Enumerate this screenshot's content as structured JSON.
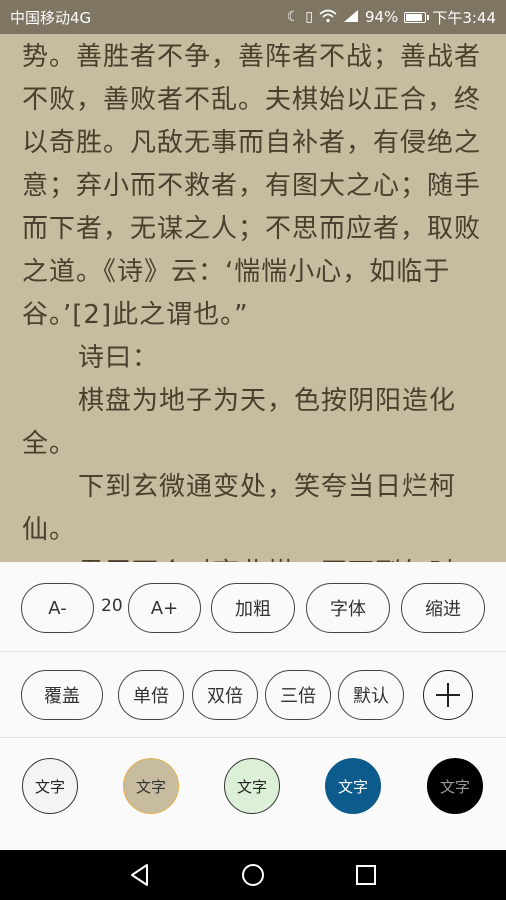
{
  "status": {
    "carrier": "中国移动4G",
    "battery_percent": "94%",
    "battery_level": 0.94,
    "time": "下午3:44",
    "icons": [
      "moon-icon",
      "vibrate-icon",
      "wifi-icon",
      "signal-icon",
      "battery-icon"
    ],
    "signal_text": "⁴⁶"
  },
  "reader": {
    "paragraphs": [
      {
        "text": "势。善胜者不争，善阵者不战；善战者不败，善败者不乱。夫棋始以正合，终以奇胜。凡敌无事而自补者，有侵绝之意；弃小而不救者，有图大之心；随手而下者，无谋之人；不思而应者，取败之道。《诗》云：‘惴惴小心，如临于谷。’[2]此之谓也。”",
        "indent": false
      },
      {
        "text": "诗曰：",
        "indent": true
      },
      {
        "text": "棋盘为地子为天，色按阴阳造化全。",
        "indent": true
      },
      {
        "text": "下到玄微通变处，笑夸当日烂柯仙。",
        "indent": true
      },
      {
        "text": "君臣两个对弈此棋，正下到午时",
        "indent": true
      }
    ]
  },
  "settings": {
    "font_decrease": "A-",
    "font_size": "20",
    "font_increase": "A+",
    "bold": "加粗",
    "font": "字体",
    "indent": "缩进",
    "page_mode": "覆盖",
    "spacing_single": "单倍",
    "spacing_double": "双倍",
    "spacing_triple": "三倍",
    "spacing_default": "默认",
    "themes": [
      {
        "label": "文字",
        "bg": "#f4f4f4",
        "fg": "#222222",
        "border": "#333333"
      },
      {
        "label": "文字",
        "bg": "#c8bca0",
        "fg": "#333333",
        "border": "#e6b34c"
      },
      {
        "label": "文字",
        "bg": "#dcefd7",
        "fg": "#222222",
        "border": "#333333"
      },
      {
        "label": "文字",
        "bg": "#0d5b8c",
        "fg": "#ffffff",
        "border": "#0d5b8c"
      },
      {
        "label": "文字",
        "bg": "#000000",
        "fg": "#9a9a9a",
        "border": "#000000"
      }
    ]
  },
  "colors": {
    "reader_bg": "#c8bca0",
    "reader_text": "#4a3f2c",
    "statusbar_bg": "#7e7562"
  }
}
